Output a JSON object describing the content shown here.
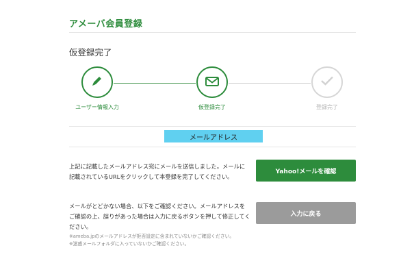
{
  "header": {
    "title": "アメーバ会員登録"
  },
  "step_heading": "仮登録完了",
  "steps": [
    {
      "label": "ユーザー情報入力",
      "icon": "pencil-icon",
      "state": "done"
    },
    {
      "label": "仮登録完了",
      "icon": "envelope-icon",
      "state": "current"
    },
    {
      "label": "登録完了",
      "icon": "check-icon",
      "state": "pending"
    }
  ],
  "email_field": {
    "label": "メールアドレス"
  },
  "section_send": {
    "message": "上記に記載したメールアドレス宛にメールを送信しました。メールに記載されているURLをクリックして本登録を完了してください。",
    "button_label": "Yahoo!メールを確認"
  },
  "section_back": {
    "message": "メールがとどかない場合、以下をご確認ください。メールアドレスをご確認の上、誤りがあった場合は入力に戻るボタンを押して修正してください。",
    "note_1": "※ameba.jpのメールアドレスが拒否設定に含まれていないかご確認ください。",
    "note_2": "※迷惑メールフォルダに入っていないかご確認ください。",
    "button_label": "入力に戻る"
  },
  "colors": {
    "brand_green": "#2d8c3c",
    "highlight": "#60d0f0",
    "inactive_gray": "#9b9b9b"
  }
}
